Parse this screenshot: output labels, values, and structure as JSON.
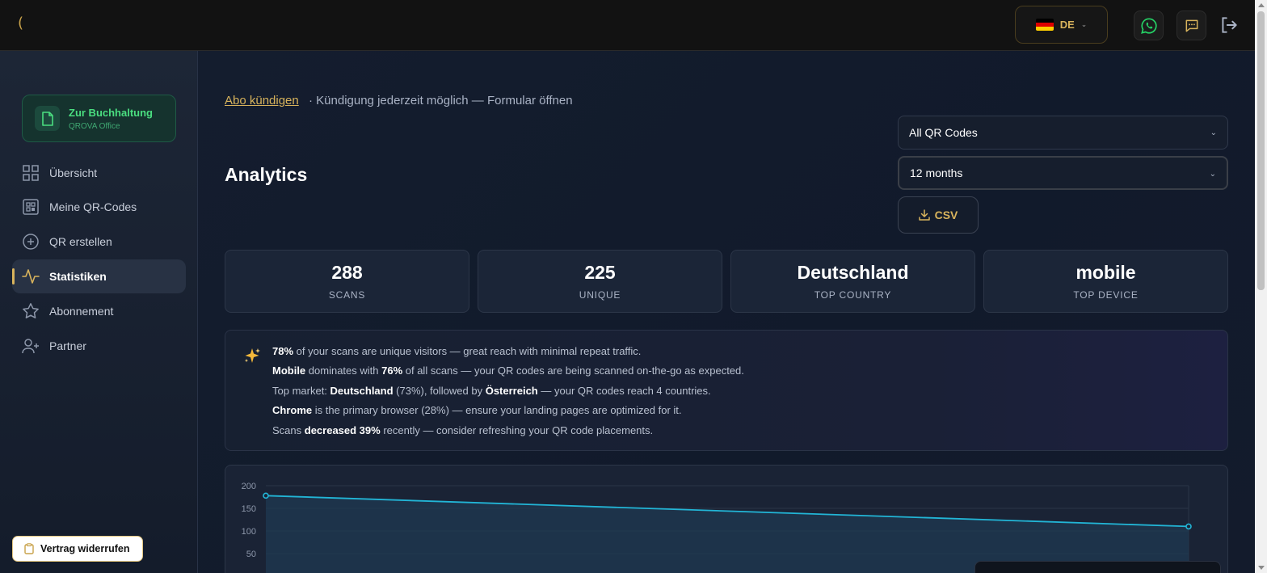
{
  "header": {
    "logo_glyph": "(",
    "language": {
      "code": "DE",
      "flag": "germany-flag"
    },
    "icons": [
      "whatsapp-icon",
      "chat-icon",
      "logout-icon"
    ]
  },
  "sidebar": {
    "accounting_card": {
      "title": "Zur Buchhaltung",
      "subtitle": "QROVA Office"
    },
    "items": [
      {
        "label": "Übersicht",
        "icon": "dashboard-grid-icon"
      },
      {
        "label": "Meine QR-Codes",
        "icon": "qr-code-icon"
      },
      {
        "label": "QR erstellen",
        "icon": "plus-circle-icon"
      },
      {
        "label": "Statistiken",
        "icon": "activity-icon",
        "active": true
      },
      {
        "label": "Abonnement",
        "icon": "star-icon"
      },
      {
        "label": "Partner",
        "icon": "user-plus-icon"
      }
    ],
    "revoke_button": "Vertrag widerrufen"
  },
  "main": {
    "cancel_link": "Abo kündigen",
    "cancel_note": "· Kündigung jederzeit möglich — Formular öffnen",
    "title": "Analytics",
    "qr_filter": {
      "selected": "All QR Codes"
    },
    "period_filter": {
      "selected": "12 months"
    },
    "csv_button": "CSV",
    "stats": [
      {
        "value": "288",
        "label": "SCANS"
      },
      {
        "value": "225",
        "label": "UNIQUE"
      },
      {
        "value": "Deutschland",
        "label": "TOP COUNTRY"
      },
      {
        "value": "mobile",
        "label": "TOP DEVICE"
      }
    ],
    "insights": {
      "l1_b1": "78%",
      "l1_t1": " of your scans are unique visitors — great reach with minimal repeat traffic.",
      "l2_b1": "Mobile",
      "l2_t1": " dominates with ",
      "l2_b2": "76%",
      "l2_t2": " of all scans — your QR codes are being scanned on-the-go as expected.",
      "l3_t1": "Top market: ",
      "l3_b1": "Deutschland",
      "l3_t2": " (73%), followed by ",
      "l3_b2": "Österreich",
      "l3_t3": " — your QR codes reach 4 countries.",
      "l4_b1": "Chrome",
      "l4_t1": " is the primary browser (28%) — ensure your landing pages are optimized for it.",
      "l5_t1": "Scans ",
      "l5_b1": "decreased 39%",
      "l5_t2": " recently — consider refreshing your QR code placements."
    }
  },
  "colors": {
    "accent": "#d8b35c",
    "green": "#4ade80",
    "line": "#22b5d6"
  },
  "chart_data": {
    "type": "area",
    "y_ticks": [
      "200",
      "150",
      "100",
      "50"
    ],
    "ylim": [
      0,
      200
    ],
    "series": [
      {
        "values": [
          178,
          110
        ]
      }
    ]
  }
}
